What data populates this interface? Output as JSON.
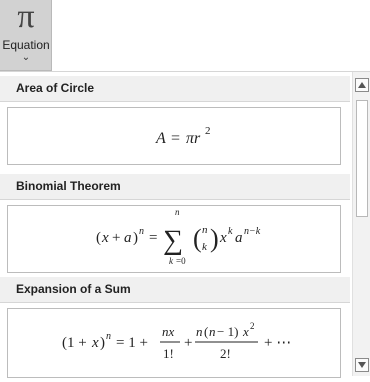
{
  "ribbon": {
    "equation_button": {
      "icon": "π",
      "label": "Equation",
      "chevron": "⌄"
    }
  },
  "gallery": {
    "sections": [
      {
        "title": "Area of Circle"
      },
      {
        "title": "Binomial Theorem"
      },
      {
        "title": "Expansion of a Sum"
      }
    ]
  }
}
